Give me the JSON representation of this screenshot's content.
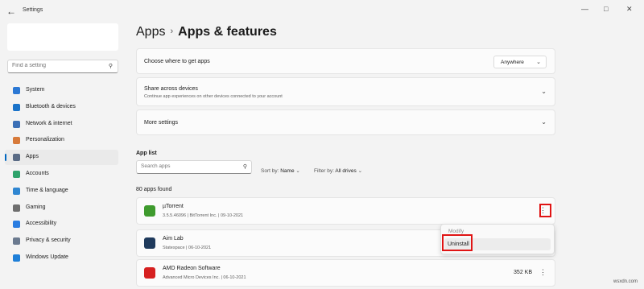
{
  "window": {
    "title": "Settings",
    "back_icon": "arrow-left-icon",
    "controls": [
      "—",
      "□",
      "✕"
    ]
  },
  "sidebar": {
    "search_placeholder": "Find a setting",
    "items": [
      {
        "label": "System",
        "icon": "monitor-icon",
        "color": "#2b78d4",
        "active": false
      },
      {
        "label": "Bluetooth & devices",
        "icon": "bluetooth-icon",
        "color": "#1a73c9",
        "active": false
      },
      {
        "label": "Network & internet",
        "icon": "wifi-icon",
        "color": "#3b6fb6",
        "active": false
      },
      {
        "label": "Personalization",
        "icon": "brush-icon",
        "color": "#d77a3a",
        "active": false
      },
      {
        "label": "Apps",
        "icon": "apps-icon",
        "color": "#5a6b85",
        "active": true
      },
      {
        "label": "Accounts",
        "icon": "person-icon",
        "color": "#2ea36b",
        "active": false
      },
      {
        "label": "Time & language",
        "icon": "globe-clock-icon",
        "color": "#2f86d1",
        "active": false
      },
      {
        "label": "Gaming",
        "icon": "gamepad-icon",
        "color": "#6e6e6e",
        "active": false
      },
      {
        "label": "Accessibility",
        "icon": "accessibility-icon",
        "color": "#2a7de1",
        "active": false
      },
      {
        "label": "Privacy & security",
        "icon": "shield-icon",
        "color": "#6b7a8f",
        "active": false
      },
      {
        "label": "Windows Update",
        "icon": "sync-icon",
        "color": "#1e7fd8",
        "active": false
      }
    ]
  },
  "breadcrumb": {
    "parent": "Apps",
    "current": "Apps & features"
  },
  "settings": {
    "get_apps_label": "Choose where to get apps",
    "get_apps_value": "Anywhere",
    "share_title": "Share across devices",
    "share_desc": "Continue app experiences on other devices connected to your account",
    "more_settings": "More settings"
  },
  "app_list": {
    "heading": "App list",
    "search_placeholder": "Search apps",
    "sort_label": "Sort by:",
    "sort_value": "Name",
    "filter_label": "Filter by:",
    "filter_value": "All drives",
    "count": "80 apps found",
    "apps": [
      {
        "name": "µTorrent",
        "meta": "3.5.5.46096  |  BitTorrent Inc.  |  09-10-2021",
        "size": "",
        "icon": "utorrent-icon",
        "color": "#3f9b2e"
      },
      {
        "name": "Aim Lab",
        "meta": "Statespace  |  06-10-2021",
        "size": "",
        "icon": "aimlab-icon",
        "color": "#1f3a5c"
      },
      {
        "name": "AMD Radeon Software",
        "meta": "Advanced Micro Devices Inc.  |  06-10-2021",
        "size": "352 KB",
        "icon": "amd-icon",
        "color": "#d62020"
      }
    ]
  },
  "context_menu": {
    "modify": "Modify",
    "uninstall": "Uninstall"
  },
  "watermark": "wsxdn.com"
}
